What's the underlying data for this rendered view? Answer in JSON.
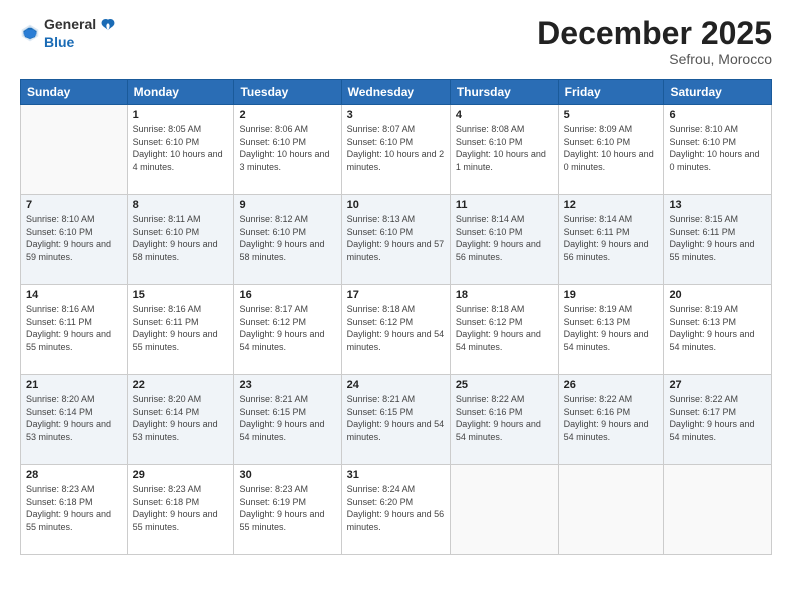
{
  "logo": {
    "general": "General",
    "blue": "Blue"
  },
  "header": {
    "month": "December 2025",
    "location": "Sefrou, Morocco"
  },
  "weekdays": [
    "Sunday",
    "Monday",
    "Tuesday",
    "Wednesday",
    "Thursday",
    "Friday",
    "Saturday"
  ],
  "weeks": [
    [
      {
        "day": "",
        "sunrise": "",
        "sunset": "",
        "daylight": ""
      },
      {
        "day": "1",
        "sunrise": "Sunrise: 8:05 AM",
        "sunset": "Sunset: 6:10 PM",
        "daylight": "Daylight: 10 hours and 4 minutes."
      },
      {
        "day": "2",
        "sunrise": "Sunrise: 8:06 AM",
        "sunset": "Sunset: 6:10 PM",
        "daylight": "Daylight: 10 hours and 3 minutes."
      },
      {
        "day": "3",
        "sunrise": "Sunrise: 8:07 AM",
        "sunset": "Sunset: 6:10 PM",
        "daylight": "Daylight: 10 hours and 2 minutes."
      },
      {
        "day": "4",
        "sunrise": "Sunrise: 8:08 AM",
        "sunset": "Sunset: 6:10 PM",
        "daylight": "Daylight: 10 hours and 1 minute."
      },
      {
        "day": "5",
        "sunrise": "Sunrise: 8:09 AM",
        "sunset": "Sunset: 6:10 PM",
        "daylight": "Daylight: 10 hours and 0 minutes."
      },
      {
        "day": "6",
        "sunrise": "Sunrise: 8:10 AM",
        "sunset": "Sunset: 6:10 PM",
        "daylight": "Daylight: 10 hours and 0 minutes."
      }
    ],
    [
      {
        "day": "7",
        "sunrise": "Sunrise: 8:10 AM",
        "sunset": "Sunset: 6:10 PM",
        "daylight": "Daylight: 9 hours and 59 minutes."
      },
      {
        "day": "8",
        "sunrise": "Sunrise: 8:11 AM",
        "sunset": "Sunset: 6:10 PM",
        "daylight": "Daylight: 9 hours and 58 minutes."
      },
      {
        "day": "9",
        "sunrise": "Sunrise: 8:12 AM",
        "sunset": "Sunset: 6:10 PM",
        "daylight": "Daylight: 9 hours and 58 minutes."
      },
      {
        "day": "10",
        "sunrise": "Sunrise: 8:13 AM",
        "sunset": "Sunset: 6:10 PM",
        "daylight": "Daylight: 9 hours and 57 minutes."
      },
      {
        "day": "11",
        "sunrise": "Sunrise: 8:14 AM",
        "sunset": "Sunset: 6:10 PM",
        "daylight": "Daylight: 9 hours and 56 minutes."
      },
      {
        "day": "12",
        "sunrise": "Sunrise: 8:14 AM",
        "sunset": "Sunset: 6:11 PM",
        "daylight": "Daylight: 9 hours and 56 minutes."
      },
      {
        "day": "13",
        "sunrise": "Sunrise: 8:15 AM",
        "sunset": "Sunset: 6:11 PM",
        "daylight": "Daylight: 9 hours and 55 minutes."
      }
    ],
    [
      {
        "day": "14",
        "sunrise": "Sunrise: 8:16 AM",
        "sunset": "Sunset: 6:11 PM",
        "daylight": "Daylight: 9 hours and 55 minutes."
      },
      {
        "day": "15",
        "sunrise": "Sunrise: 8:16 AM",
        "sunset": "Sunset: 6:11 PM",
        "daylight": "Daylight: 9 hours and 55 minutes."
      },
      {
        "day": "16",
        "sunrise": "Sunrise: 8:17 AM",
        "sunset": "Sunset: 6:12 PM",
        "daylight": "Daylight: 9 hours and 54 minutes."
      },
      {
        "day": "17",
        "sunrise": "Sunrise: 8:18 AM",
        "sunset": "Sunset: 6:12 PM",
        "daylight": "Daylight: 9 hours and 54 minutes."
      },
      {
        "day": "18",
        "sunrise": "Sunrise: 8:18 AM",
        "sunset": "Sunset: 6:12 PM",
        "daylight": "Daylight: 9 hours and 54 minutes."
      },
      {
        "day": "19",
        "sunrise": "Sunrise: 8:19 AM",
        "sunset": "Sunset: 6:13 PM",
        "daylight": "Daylight: 9 hours and 54 minutes."
      },
      {
        "day": "20",
        "sunrise": "Sunrise: 8:19 AM",
        "sunset": "Sunset: 6:13 PM",
        "daylight": "Daylight: 9 hours and 54 minutes."
      }
    ],
    [
      {
        "day": "21",
        "sunrise": "Sunrise: 8:20 AM",
        "sunset": "Sunset: 6:14 PM",
        "daylight": "Daylight: 9 hours and 53 minutes."
      },
      {
        "day": "22",
        "sunrise": "Sunrise: 8:20 AM",
        "sunset": "Sunset: 6:14 PM",
        "daylight": "Daylight: 9 hours and 53 minutes."
      },
      {
        "day": "23",
        "sunrise": "Sunrise: 8:21 AM",
        "sunset": "Sunset: 6:15 PM",
        "daylight": "Daylight: 9 hours and 54 minutes."
      },
      {
        "day": "24",
        "sunrise": "Sunrise: 8:21 AM",
        "sunset": "Sunset: 6:15 PM",
        "daylight": "Daylight: 9 hours and 54 minutes."
      },
      {
        "day": "25",
        "sunrise": "Sunrise: 8:22 AM",
        "sunset": "Sunset: 6:16 PM",
        "daylight": "Daylight: 9 hours and 54 minutes."
      },
      {
        "day": "26",
        "sunrise": "Sunrise: 8:22 AM",
        "sunset": "Sunset: 6:16 PM",
        "daylight": "Daylight: 9 hours and 54 minutes."
      },
      {
        "day": "27",
        "sunrise": "Sunrise: 8:22 AM",
        "sunset": "Sunset: 6:17 PM",
        "daylight": "Daylight: 9 hours and 54 minutes."
      }
    ],
    [
      {
        "day": "28",
        "sunrise": "Sunrise: 8:23 AM",
        "sunset": "Sunset: 6:18 PM",
        "daylight": "Daylight: 9 hours and 55 minutes."
      },
      {
        "day": "29",
        "sunrise": "Sunrise: 8:23 AM",
        "sunset": "Sunset: 6:18 PM",
        "daylight": "Daylight: 9 hours and 55 minutes."
      },
      {
        "day": "30",
        "sunrise": "Sunrise: 8:23 AM",
        "sunset": "Sunset: 6:19 PM",
        "daylight": "Daylight: 9 hours and 55 minutes."
      },
      {
        "day": "31",
        "sunrise": "Sunrise: 8:24 AM",
        "sunset": "Sunset: 6:20 PM",
        "daylight": "Daylight: 9 hours and 56 minutes."
      },
      {
        "day": "",
        "sunrise": "",
        "sunset": "",
        "daylight": ""
      },
      {
        "day": "",
        "sunrise": "",
        "sunset": "",
        "daylight": ""
      },
      {
        "day": "",
        "sunrise": "",
        "sunset": "",
        "daylight": ""
      }
    ]
  ]
}
